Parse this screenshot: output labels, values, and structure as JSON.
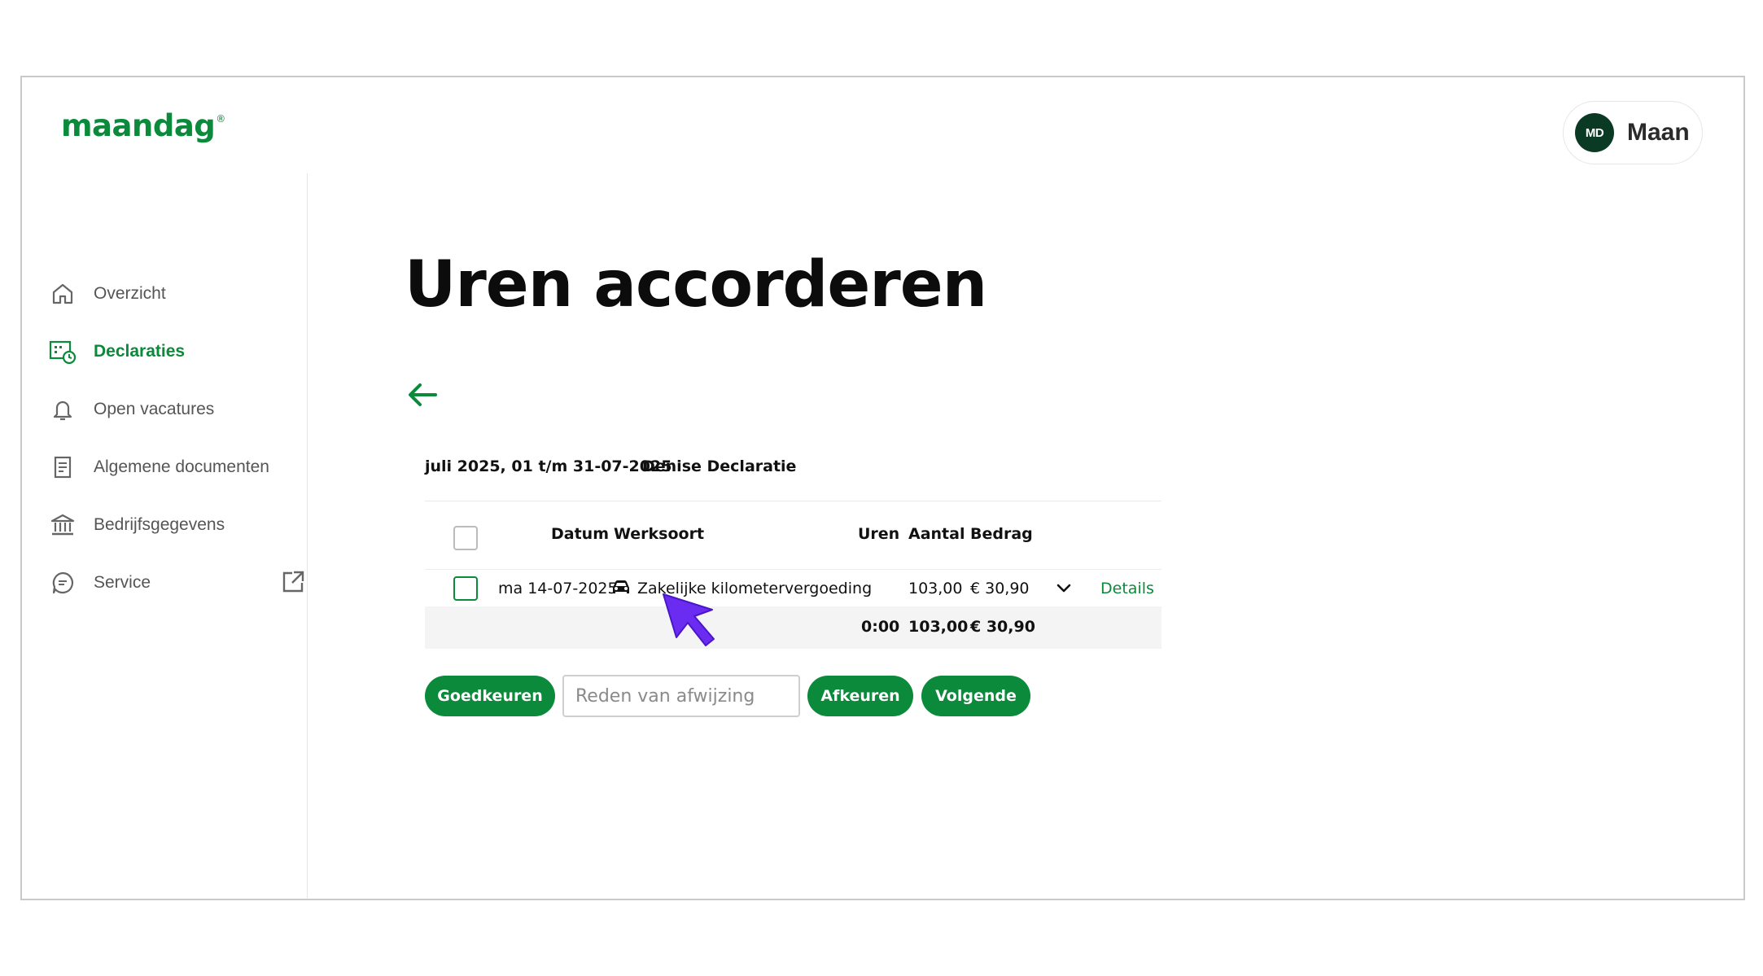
{
  "app": {
    "logo_text": "maandag",
    "logo_mark": "®",
    "brand_color": "#0a8a3a"
  },
  "user": {
    "initials": "MD",
    "name": "Maan"
  },
  "sidebar": {
    "items": [
      {
        "label": "Overzicht",
        "icon": "home-icon",
        "active": false
      },
      {
        "label": "Declaraties",
        "icon": "declarations-icon",
        "active": true
      },
      {
        "label": "Open vacatures",
        "icon": "bell-icon",
        "active": false
      },
      {
        "label": "Algemene documenten",
        "icon": "document-icon",
        "active": false
      },
      {
        "label": "Bedrijfsgegevens",
        "icon": "bank-icon",
        "active": false
      },
      {
        "label": "Service",
        "icon": "chat-icon",
        "active": false,
        "external": true
      }
    ]
  },
  "main": {
    "title": "Uren accorderen",
    "period": "juli 2025, 01 t/m 31-07-2025",
    "person": "Denise Declaratie",
    "table": {
      "headers": {
        "datum": "Datum",
        "werksoort": "Werksoort",
        "uren": "Uren",
        "aantal": "Aantal",
        "bedrag": "Bedrag"
      },
      "rows": [
        {
          "datum": "ma 14-07-2025",
          "werksoort": "Zakelijke kilometervergoeding",
          "werksoort_icon": "car-icon",
          "uren": "",
          "aantal": "103,00",
          "bedrag": "€ 30,90",
          "details_label": "Details"
        }
      ],
      "totals": {
        "uren": "0:00",
        "aantal": "103,00",
        "bedrag": "€ 30,90"
      }
    },
    "actions": {
      "approve_label": "Goedkeuren",
      "reason_placeholder": "Reden van afwijzing",
      "reject_label": "Afkeuren",
      "next_label": "Volgende"
    }
  }
}
